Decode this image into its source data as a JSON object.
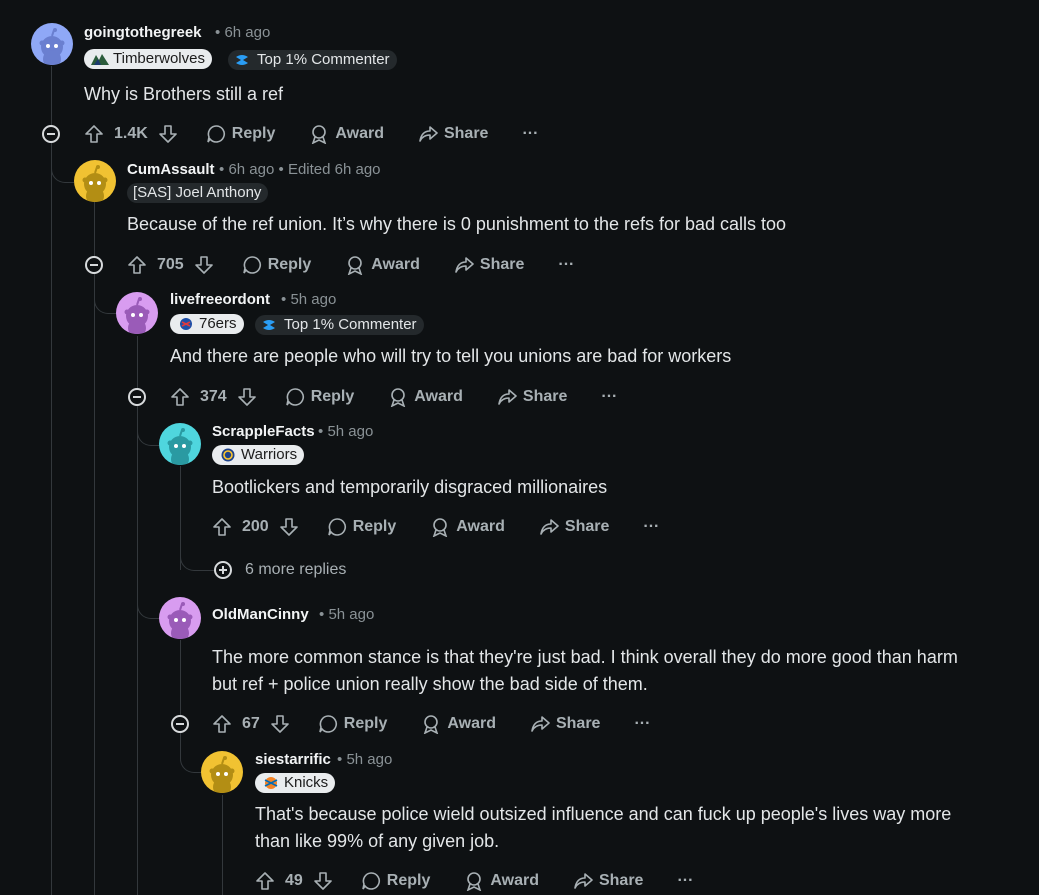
{
  "comments": [
    {
      "username": "goingtothegreek",
      "time": "6h ago",
      "flairs": [
        {
          "label": "Timberwolves",
          "icon": "timberwolves-logo"
        },
        {
          "label": "Top 1% Commenter",
          "icon": "top-commenter-icon"
        }
      ],
      "body": [
        "Why is Brothers still a ref"
      ],
      "score": "1.4K",
      "avatar_color": "#8fa8f7"
    },
    {
      "username": "CumAssault",
      "time": "6h ago",
      "edited": "Edited 6h ago",
      "flairs": [
        {
          "label": "[SAS] Joel Anthony"
        }
      ],
      "body": [
        "Because of the ref union. It’s why there is 0 punishment to the refs for bad calls too"
      ],
      "score": "705",
      "avatar_color": "#f1c232"
    },
    {
      "username": "livefreeordont",
      "time": "5h ago",
      "flairs": [
        {
          "label": "76ers",
          "icon": "76ers-logo"
        },
        {
          "label": "Top 1% Commenter",
          "icon": "top-commenter-icon"
        }
      ],
      "body": [
        "And there are people who will try to tell you unions are bad for workers"
      ],
      "score": "374",
      "avatar_color": "#d89cf0"
    },
    {
      "username": "ScrappleFacts",
      "time": "5h ago",
      "flairs": [
        {
          "label": "Warriors",
          "icon": "warriors-logo"
        }
      ],
      "body": [
        "Bootlickers and temporarily disgraced millionaires"
      ],
      "score": "200",
      "avatar_color": "#4fd6de"
    },
    {
      "username": "OldManCinny",
      "time": "5h ago",
      "flairs": [],
      "body": [
        "The more common stance is that they're just bad. I think overall they do more good than harm",
        "but ref + police union really show the bad side of them."
      ],
      "score": "67",
      "avatar_color": "#d89cf0"
    },
    {
      "username": "siestarrific",
      "time": "5h ago",
      "flairs": [
        {
          "label": "Knicks",
          "icon": "knicks-logo"
        }
      ],
      "body": [
        "That's because police wield outsized influence and can fuck up people's lives way more",
        "than like 99% of any given job."
      ],
      "score": "49",
      "avatar_color": "#f1c232"
    }
  ],
  "actions": {
    "reply": "Reply",
    "award": "Award",
    "share": "Share",
    "more": "···"
  },
  "more_replies": "6 more replies",
  "separator": "•"
}
